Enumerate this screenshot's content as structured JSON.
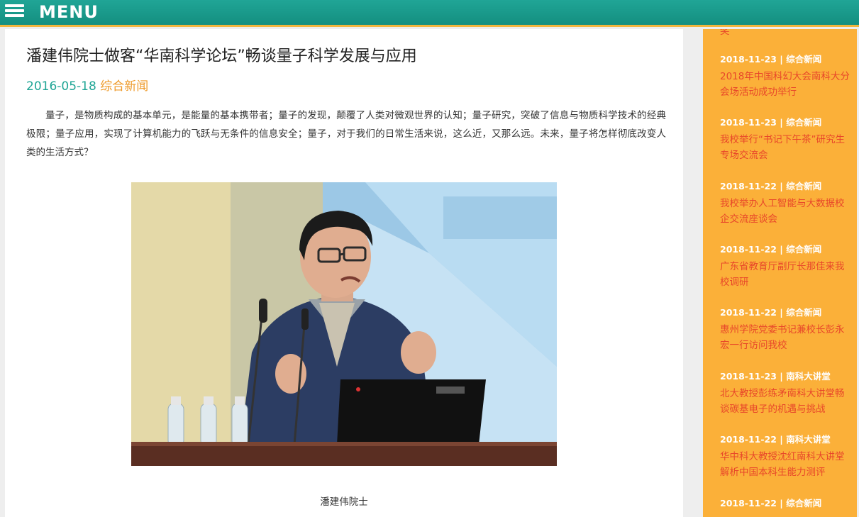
{
  "header": {
    "menu_label": "MENU"
  },
  "article": {
    "title": "潘建伟院士做客“华南科学论坛”畅谈量子科学发展与应用",
    "date": "2016-05-18",
    "category": "综合新闻",
    "paragraph": "量子，是物质构成的基本单元，是能量的基本携带者；量子的发现，颠覆了人类对微观世界的认知；量子研究，突破了信息与物质科学技术的经典极限；量子应用，实现了计算机能力的飞跃与无条件的信息安全；量子，对于我们的日常生活来说，这么近，又那么远。未来，量子将怎样彻底改变人类的生活方式？",
    "image_caption": "潘建伟院士"
  },
  "sidebar": {
    "top_fragment": "奖",
    "items": [
      {
        "meta": "2018-11-23 | 综合新闻",
        "title": "2018年中国科幻大会南科大分会场活动成功举行"
      },
      {
        "meta": "2018-11-23 | 综合新闻",
        "title": "我校举行“书记下午茶”研究生专场交流会"
      },
      {
        "meta": "2018-11-22 | 综合新闻",
        "title": "我校举办人工智能与大数据校企交流座谈会"
      },
      {
        "meta": "2018-11-22 | 综合新闻",
        "title": "广东省教育厅副厅长那佳来我校调研"
      },
      {
        "meta": "2018-11-22 | 综合新闻",
        "title": "惠州学院党委书记兼校长彭永宏一行访问我校"
      },
      {
        "meta": "2018-11-23 | 南科大讲堂",
        "title": "北大教授彭练矛南科大讲堂畅谈碳基电子的机遇与挑战"
      },
      {
        "meta": "2018-11-22 | 南科大讲堂",
        "title": "华中科大教授沈红南科大讲堂解析中国本科生能力测评"
      },
      {
        "meta": "2018-11-22 | 综合新闻",
        "title": ""
      }
    ]
  },
  "colors": {
    "header": "#1a9a8a",
    "accent": "#f2b53d",
    "sidebar": "#fbb039",
    "link": "#e8472a",
    "date": "#1fa595",
    "category": "#ee9a2a"
  }
}
